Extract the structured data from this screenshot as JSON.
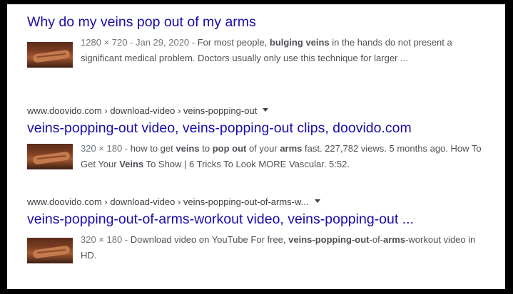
{
  "results": [
    {
      "title": "Why do my veins pop out of my arms",
      "meta": "1280 × 720 - Jan 29, 2020 - ",
      "snippet": [
        {
          "t": "For most people, ",
          "b": false
        },
        {
          "t": "bulging veins",
          "b": true
        },
        {
          "t": " in the hands do not present a significant medical problem. Doctors usually only use this technique for larger ...",
          "b": false
        }
      ]
    },
    {
      "url": "www.doovido.com › download-video › veins-popping-out",
      "title": "veins-popping-out video, veins-popping-out clips, doovido.com",
      "meta": "320 × 180 - ",
      "snippet": [
        {
          "t": "how to get ",
          "b": false
        },
        {
          "t": "veins",
          "b": true
        },
        {
          "t": " to ",
          "b": false
        },
        {
          "t": "pop out",
          "b": true
        },
        {
          "t": " of your ",
          "b": false
        },
        {
          "t": "arms",
          "b": true
        },
        {
          "t": " fast. 227,782 views. 5 months ago. How To Get Your ",
          "b": false
        },
        {
          "t": "Veins",
          "b": true
        },
        {
          "t": " To Show | 6 Tricks To Look MORE Vascular. 5:52.",
          "b": false
        }
      ]
    },
    {
      "url": "www.doovido.com › download-video › veins-popping-out-of-arms-w...",
      "title": "veins-popping-out-of-arms-workout video, veins-popping-out ...",
      "meta": "320 × 180 - ",
      "snippet": [
        {
          "t": "Download video on YouTube For free, ",
          "b": false
        },
        {
          "t": "veins-popping-out",
          "b": true
        },
        {
          "t": "-of-",
          "b": false
        },
        {
          "t": "arms",
          "b": true
        },
        {
          "t": "-workout video in HD.",
          "b": false
        }
      ]
    }
  ],
  "icons": {
    "url_menu": "caret-down-icon",
    "thumbnail": "video-thumbnail"
  },
  "colors": {
    "title": "#1a0dab",
    "url": "#3c4043",
    "snippet": "#4d5156",
    "meta": "#70757a"
  }
}
